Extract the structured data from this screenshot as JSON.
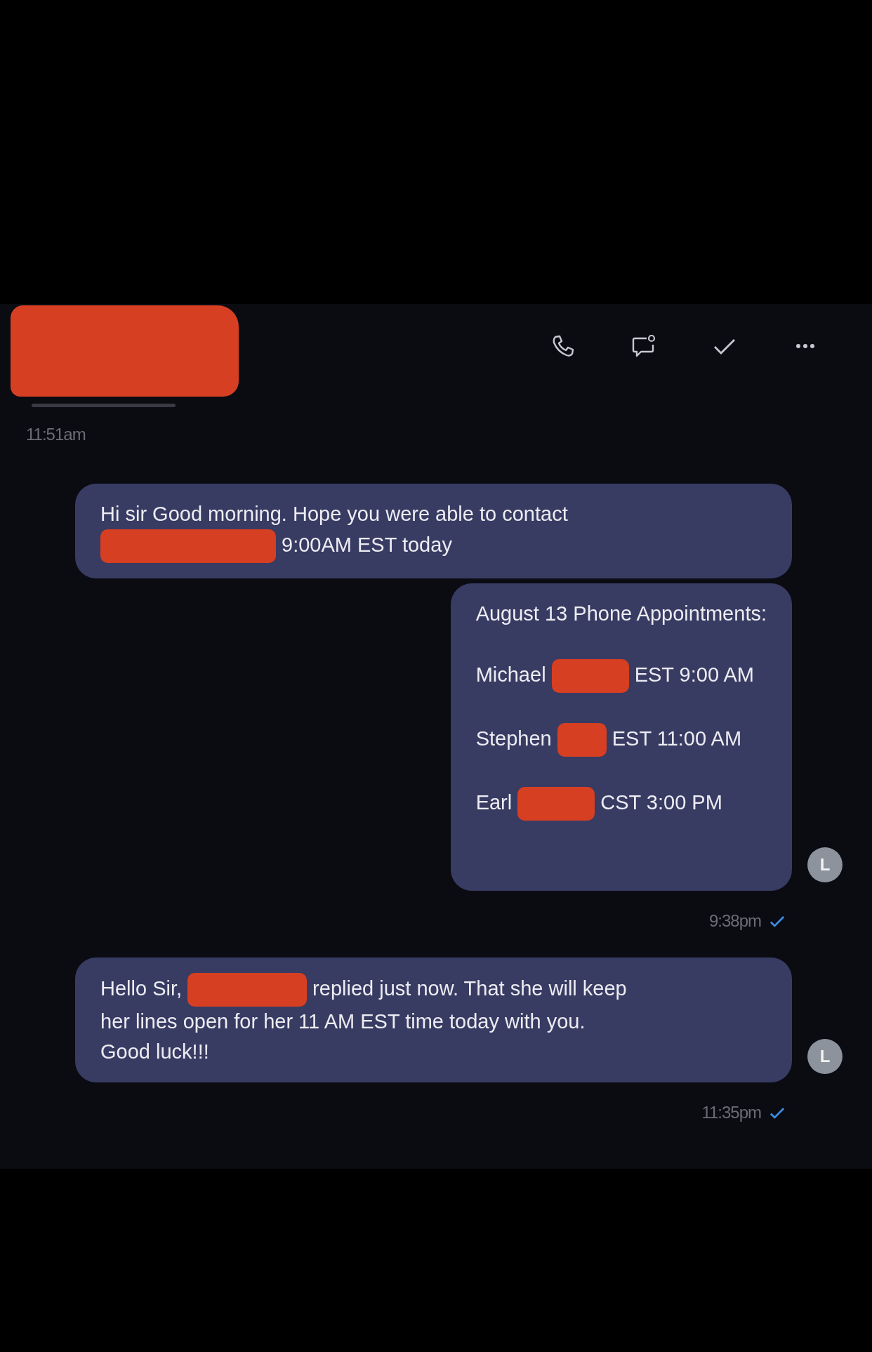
{
  "header": {
    "redacted_name": true,
    "actions": [
      {
        "kind": "call"
      },
      {
        "kind": "chat"
      },
      {
        "kind": "check"
      },
      {
        "kind": "more"
      }
    ]
  },
  "feed": [
    {
      "kind": "time",
      "text": "11:51am"
    },
    {
      "kind": "message",
      "lines": [
        [
          "Hi sir Good morning. Hope you were able to contact"
        ],
        [
          {
            "kind": "redaction_long"
          },
          "9:00AM EST today"
        ]
      ]
    },
    {
      "kind": "list_message",
      "avatar": "L",
      "lines": [
        [
          "August 13 Phone Appointments:"
        ],
        [
          "Michael",
          {
            "kind": "redaction"
          },
          "EST 9:00 AM"
        ],
        [
          "Stephen",
          {
            "kind": "redaction_short"
          },
          "EST 11:00 AM"
        ],
        [
          "Earl",
          {
            "kind": "redaction"
          },
          "CST 3:00 PM"
        ]
      ]
    },
    {
      "kind": "receipt",
      "text": "9:38pm",
      "read": true
    },
    {
      "kind": "message",
      "avatar": "L",
      "lines": [
        [
          "Hello Sir,",
          {
            "kind": "redaction_wide"
          },
          "replied just now. That she will keep"
        ],
        [
          "her lines open for her 11 AM EST time today with you."
        ],
        [
          "Good luck!!!"
        ]
      ]
    },
    {
      "kind": "receipt",
      "text": "11:35pm",
      "read": true
    }
  ]
}
